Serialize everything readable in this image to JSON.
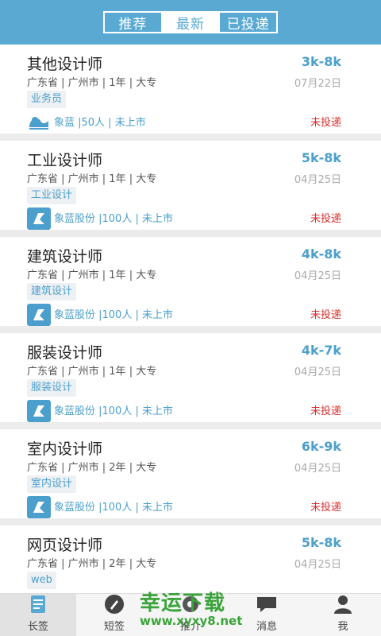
{
  "header": {
    "tabs": [
      "推荐",
      "最新",
      "已投递"
    ],
    "active_index": 1
  },
  "jobs": [
    {
      "title": "其他设计师",
      "salary": "3k-8k",
      "meta": "广东省 | 广州市 | 1年 | 大专",
      "date": "07月22日",
      "tag": "业务员",
      "company": "象蓝 |50人 |  未上市",
      "status": "未投递",
      "logo": "wave-logo-icon"
    },
    {
      "title": "工业设计师",
      "salary": "5k-8k",
      "meta": "广东省 | 广州市 | 1年 | 大专",
      "date": "04月25日",
      "tag": "工业设计",
      "company": "象蓝股份 |100人 |  未上市",
      "status": "未投递",
      "logo": "company-logo-icon"
    },
    {
      "title": "建筑设计师",
      "salary": "4k-8k",
      "meta": "广东省 | 广州市 | 1年 | 大专",
      "date": "04月25日",
      "tag": "建筑设计",
      "company": "象蓝股份 |100人 |  未上市",
      "status": "未投递",
      "logo": "company-logo-icon"
    },
    {
      "title": "服装设计师",
      "salary": "4k-7k",
      "meta": "广东省 | 广州市 | 1年 | 大专",
      "date": "04月25日",
      "tag": "服装设计",
      "company": "象蓝股份 |100人 |  未上市",
      "status": "未投递",
      "logo": "company-logo-icon"
    },
    {
      "title": "室内设计师",
      "salary": "6k-9k",
      "meta": "广东省 | 广州市 | 2年 | 大专",
      "date": "04月25日",
      "tag": "室内设计",
      "company": "象蓝股份 |100人 |  未上市",
      "status": "未投递",
      "logo": "company-logo-icon"
    },
    {
      "title": "网页设计师",
      "salary": "5k-8k",
      "meta": "广东省 | 广州市 | 2年 | 大专",
      "date": "04月25日",
      "tag": "web",
      "company": "",
      "status": "",
      "logo": ""
    }
  ],
  "tabbar": [
    {
      "label": "长签",
      "icon": "document-icon"
    },
    {
      "label": "短签",
      "icon": "pen-icon"
    },
    {
      "label": "推介",
      "icon": "gear-icon"
    },
    {
      "label": "消息",
      "icon": "chat-icon"
    },
    {
      "label": "我",
      "icon": "user-icon"
    }
  ],
  "tabbar_active_index": 0,
  "watermark": {
    "text": "幸运下载",
    "url": "www.xyxy8.net"
  },
  "colors": {
    "accent": "#5aa9d2",
    "link": "#4b9fcc",
    "status_red": "#d93030",
    "watermark_green": "#3aa33a"
  }
}
